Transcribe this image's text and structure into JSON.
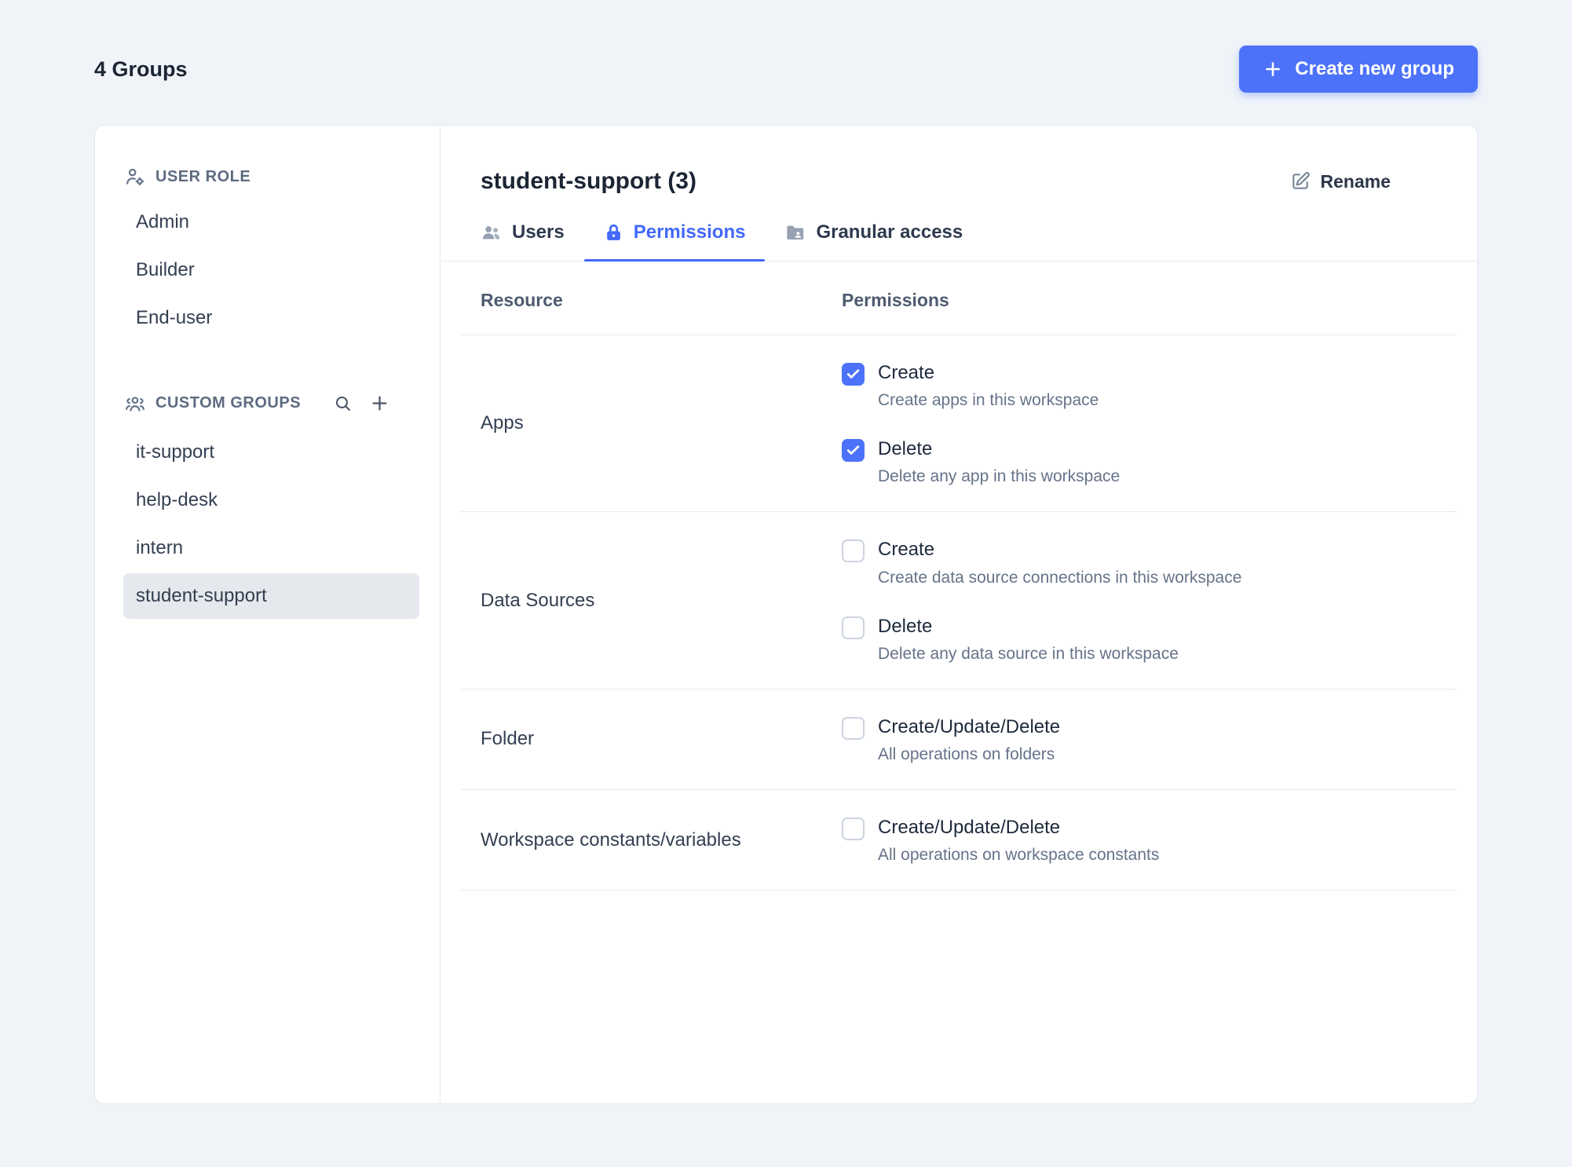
{
  "header": {
    "title": "4 Groups",
    "create_button": "Create new group"
  },
  "sidebar": {
    "user_role": {
      "label": "USER ROLE",
      "items": [
        "Admin",
        "Builder",
        "End-user"
      ]
    },
    "custom_groups": {
      "label": "CUSTOM GROUPS",
      "items": [
        "it-support",
        "help-desk",
        "intern",
        "student-support"
      ],
      "selected": "student-support"
    }
  },
  "panel": {
    "title": "student-support (3)",
    "rename": "Rename",
    "tabs": [
      {
        "label": "Users",
        "active": false
      },
      {
        "label": "Permissions",
        "active": true
      },
      {
        "label": "Granular access",
        "active": false
      }
    ],
    "table": {
      "resource_header": "Resource",
      "permissions_header": "Permissions",
      "rows": [
        {
          "resource": "Apps",
          "permissions": [
            {
              "label": "Create",
              "description": "Create apps in this workspace",
              "checked": true
            },
            {
              "label": "Delete",
              "description": "Delete any app in this workspace",
              "checked": true
            }
          ]
        },
        {
          "resource": "Data Sources",
          "permissions": [
            {
              "label": "Create",
              "description": "Create data source connections in this workspace",
              "checked": false
            },
            {
              "label": "Delete",
              "description": "Delete any data source in this workspace",
              "checked": false
            }
          ]
        },
        {
          "resource": "Folder",
          "permissions": [
            {
              "label": "Create/Update/Delete",
              "description": "All operations on folders",
              "checked": false
            }
          ]
        },
        {
          "resource": "Workspace constants/variables",
          "permissions": [
            {
              "label": "Create/Update/Delete",
              "description": "All operations on workspace constants",
              "checked": false
            }
          ]
        }
      ]
    }
  },
  "colors": {
    "accent": "#4368fa",
    "button_blue": "#4d72fa",
    "checkbox_checked": "#4d72fa",
    "selected_item_bg": "#e5e8ec"
  }
}
